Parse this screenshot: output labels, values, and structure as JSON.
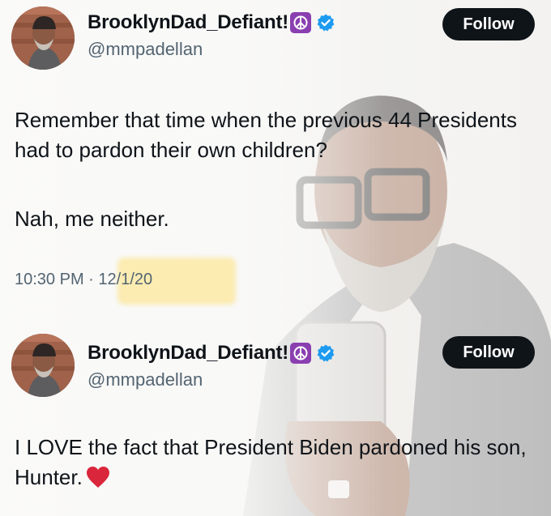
{
  "tweets": [
    {
      "author": {
        "display_name": "BrooklynDad_Defiant!",
        "handle": "@mmpadellan",
        "badge_icon": "peace-symbol-icon",
        "verified_icon": "verified-badge-icon"
      },
      "follow_label": "Follow",
      "paragraphs": [
        "Remember that time when the previous 44 Presidents had to pardon their own children?",
        "Nah, me neither."
      ],
      "time": "10:30 PM",
      "separator": "·",
      "date": "12/1/20"
    },
    {
      "author": {
        "display_name": "BrooklynDad_Defiant!",
        "handle": "@mmpadellan",
        "badge_icon": "peace-symbol-icon",
        "verified_icon": "verified-badge-icon"
      },
      "follow_label": "Follow",
      "paragraphs": [
        "I LOVE the fact that President Biden pardoned his son, Hunter."
      ],
      "trailing_icon": "red-heart-icon"
    }
  ],
  "colors": {
    "follow_button_bg": "#0f1419",
    "verified_blue": "#1d9bf0",
    "peace_badge_purple": "#8a3fb0",
    "date_highlight": "#ffdc5a",
    "heart_red": "#d9263b"
  }
}
